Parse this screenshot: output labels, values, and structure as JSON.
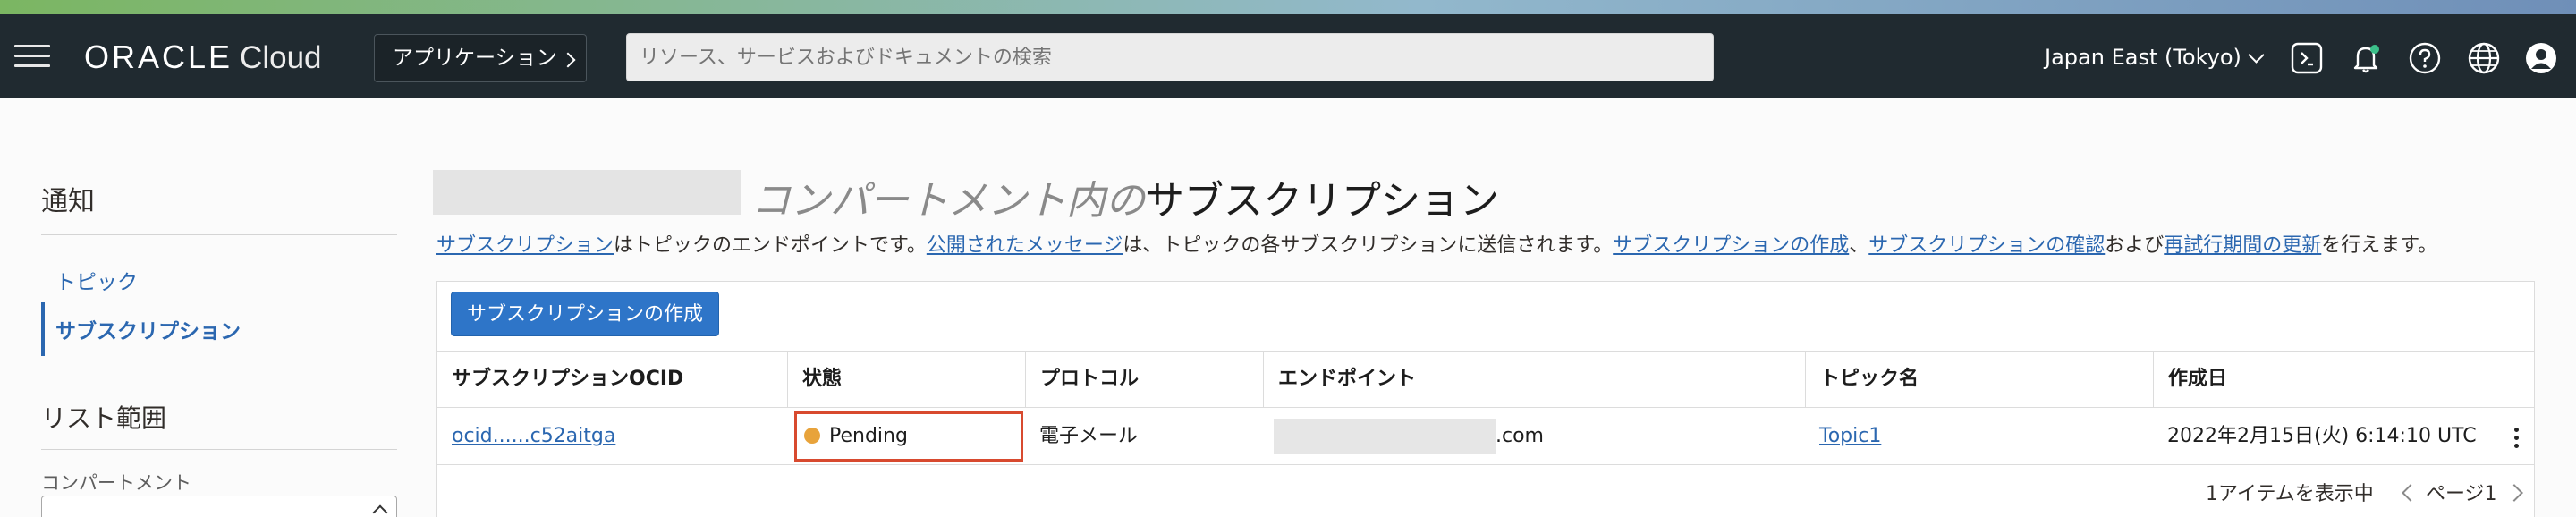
{
  "header": {
    "brand": "ORACLE",
    "product": "Cloud",
    "apps_button": "アプリケーション",
    "search_placeholder": "リソース、サービスおよびドキュメントの検索",
    "region": "Japan East (Tokyo)",
    "icons": [
      "cloud-shell-icon",
      "bell-icon",
      "help-icon",
      "globe-icon",
      "profile-icon"
    ]
  },
  "sidebar": {
    "title": "通知",
    "items": [
      {
        "label": "トピック",
        "active": false
      },
      {
        "label": "サブスクリプション",
        "active": true
      }
    ],
    "scope_title": "リスト範囲",
    "compartment_label": "コンパートメント"
  },
  "main": {
    "title_italic": "コンパートメント内の",
    "title_main": "サブスクリプション",
    "description": {
      "link1": "サブスクリプション",
      "text1": "はトピックのエンドポイントです。",
      "link2": "公開されたメッセージ",
      "text2": "は、トピックの各サブスクリプションに送信されます。",
      "link3": "サブスクリプションの作成",
      "text3": "、",
      "link4": "サブスクリプションの確認",
      "text4": "および",
      "link5": "再試行期間の更新",
      "text5": "を行えます。"
    },
    "create_button": "サブスクリプションの作成",
    "table": {
      "columns": [
        "サブスクリプションOCID",
        "状態",
        "プロトコル",
        "エンドポイント",
        "トピック名",
        "作成日"
      ],
      "rows": [
        {
          "ocid": "ocid......c52aitga",
          "status": "Pending",
          "status_color": "#e8a33b",
          "protocol": "電子メール",
          "endpoint_suffix": ".com",
          "topic": "Topic1",
          "created": "2022年2月15日(火) 6:14:10 UTC"
        }
      ]
    },
    "footer": {
      "items_shown": "1アイテムを表示中",
      "page": "ページ1"
    }
  },
  "colors": {
    "link": "#2b67b0",
    "primary_button": "#2e75c8",
    "header_bg": "#202a30",
    "highlight_border": "#d84a2f"
  }
}
